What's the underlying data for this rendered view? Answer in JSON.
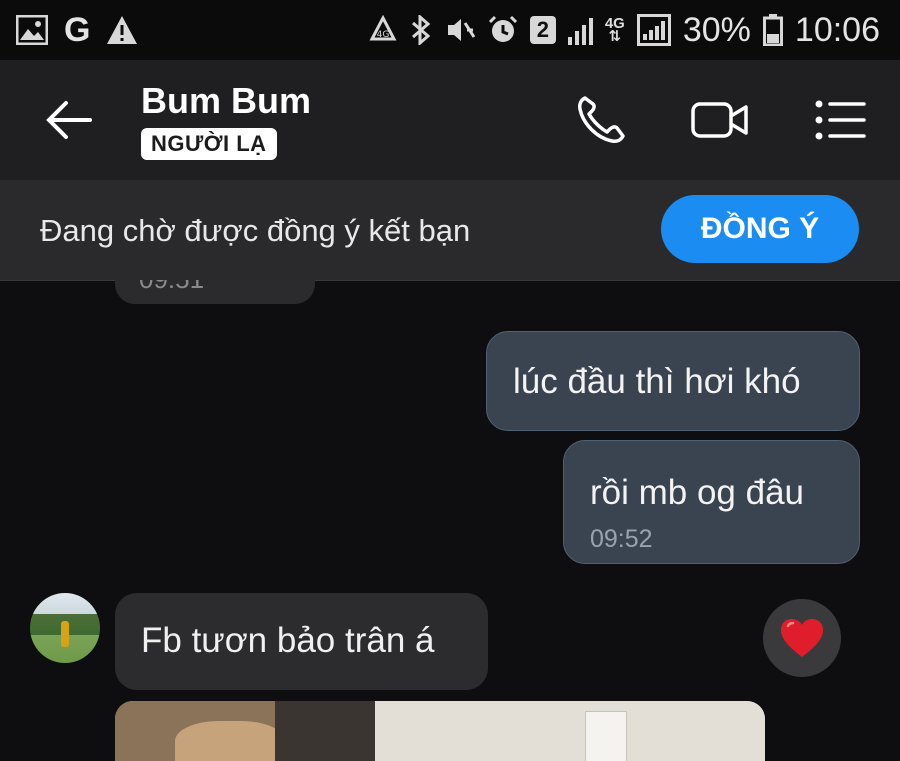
{
  "status_bar": {
    "left_icons": [
      "image-icon",
      "google-g-icon",
      "warning-icon"
    ],
    "google_letter": "G",
    "right_icons": [
      "data-saver-icon",
      "bluetooth-icon",
      "vibrate-icon",
      "alarm-icon",
      "sim-2-icon",
      "signal-icon",
      "4g-icon",
      "signal-full-icon",
      "battery-icon"
    ],
    "sim_number": "2",
    "network_label": "4G",
    "battery": "30%",
    "time": "10:06"
  },
  "header": {
    "contact_name": "Bum Bum",
    "badge": "NGƯỜI LẠ",
    "icons": [
      "back-arrow-icon",
      "phone-icon",
      "video-icon",
      "menu-list-icon"
    ]
  },
  "friend_request": {
    "text": "Đang chờ được đồng ý kết bạn",
    "button_label": "ĐỒNG Ý",
    "button_color": "#1a8cf2"
  },
  "messages": {
    "clipped_time": "09:51",
    "outgoing": [
      {
        "text": "lúc đầu thì hơi khó"
      },
      {
        "text": "rồi mb og đâu",
        "time": "09:52"
      }
    ],
    "incoming": [
      {
        "text": "Fb tươn bảo trân á",
        "reaction": "heart-icon"
      }
    ]
  },
  "colors": {
    "background": "#0e0e10",
    "outgoing_bubble": "#3a4350",
    "incoming_bubble": "#2c2c2e",
    "reaction_heart": "#e01e2b"
  }
}
